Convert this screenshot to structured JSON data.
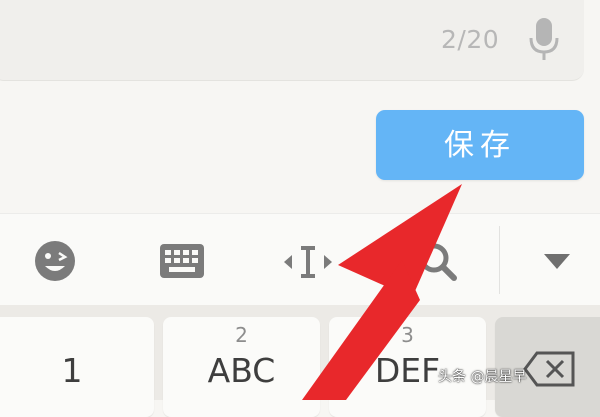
{
  "input": {
    "counter": "2/20"
  },
  "actions": {
    "save_label": "保存"
  },
  "keyboard": {
    "toolbar_icons": [
      "emoji-icon",
      "keyboard-icon",
      "cursor-move-icon",
      "search-icon",
      "collapse-keyboard-icon"
    ],
    "keys": [
      {
        "number": "",
        "label": "1"
      },
      {
        "number": "2",
        "label": "ABC"
      },
      {
        "number": "3",
        "label": "DEF"
      }
    ]
  },
  "watermark": "头条 @晨星早",
  "colors": {
    "save_button": "#64b5f6",
    "arrow": "#e8282b",
    "counter": "#b7b7b7"
  }
}
